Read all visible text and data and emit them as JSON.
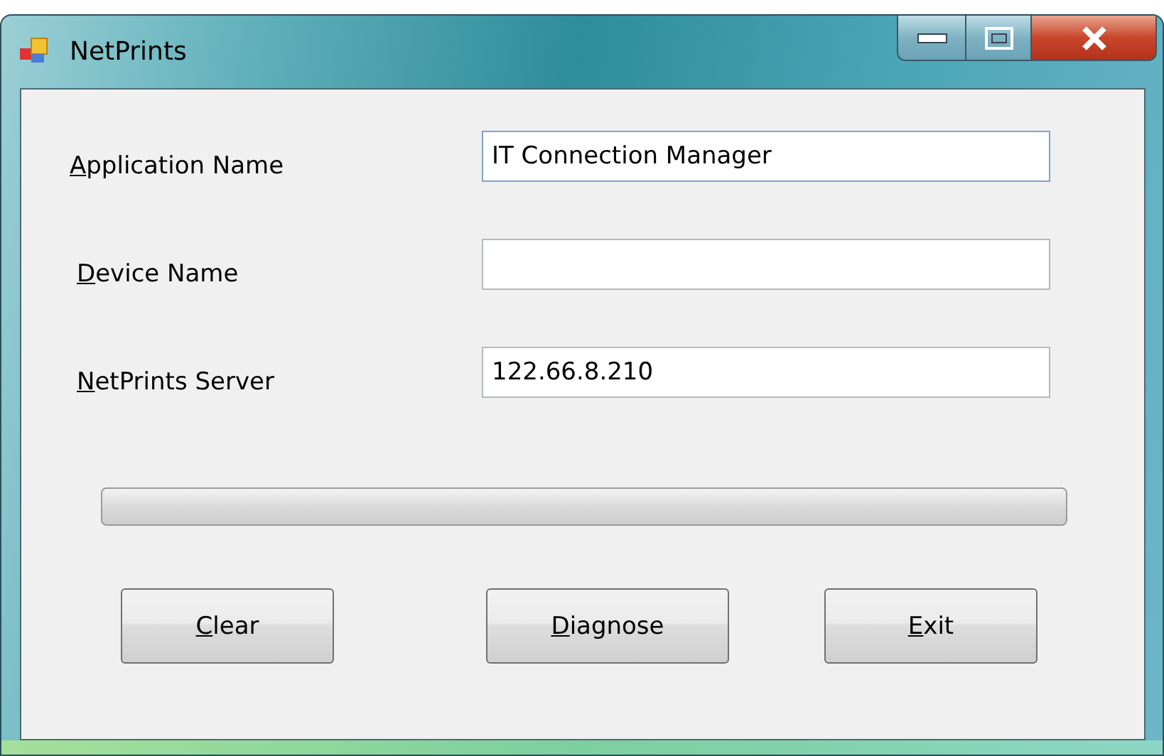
{
  "window": {
    "title": "NetPrints"
  },
  "fields": [
    {
      "label": "Application Name",
      "value": "IT Connection Manager",
      "focused": true
    },
    {
      "label": "Device Name",
      "focused": false
    },
    {
      "label": "NetPrints Server",
      "value": "122.66.8.210",
      "focused": false
    }
  ],
  "progress": {
    "level": 0
  },
  "buttons": [
    "Clear",
    "Diagnose",
    "Exit"
  ]
}
